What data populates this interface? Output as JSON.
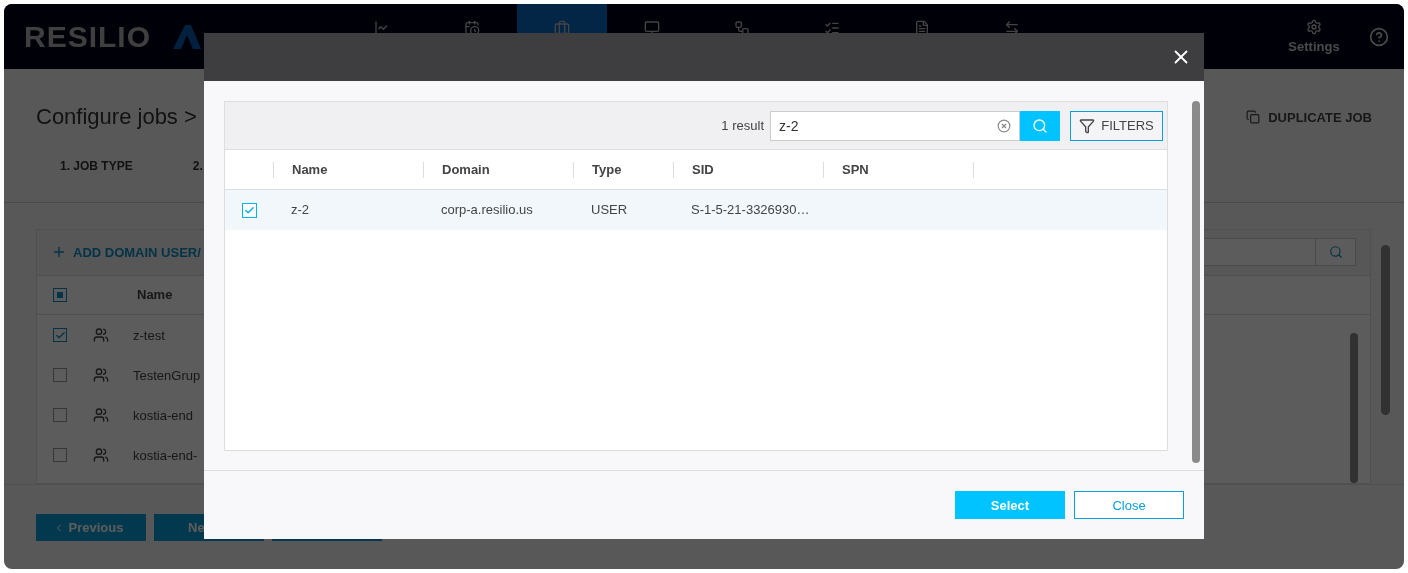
{
  "app": {
    "logo": "RESILIO",
    "nav": [
      {
        "selected": false
      },
      {
        "selected": false
      },
      {
        "selected": true
      },
      {
        "selected": false
      },
      {
        "selected": false
      },
      {
        "selected": false
      },
      {
        "selected": false
      },
      {
        "selected": false
      }
    ],
    "settings": "Settings"
  },
  "page": {
    "title": "Configure jobs >",
    "duplicate": "DUPLICATE JOB",
    "steps": [
      "1. JOB TYPE",
      "2."
    ],
    "add_button": "ADD DOMAIN USER/",
    "table": {
      "header_indeterminate": true,
      "column": "Name",
      "rows": [
        {
          "name": "z-test",
          "checked": true
        },
        {
          "name": "TestenGrup",
          "checked": false
        },
        {
          "name": "kostia-end",
          "checked": false
        },
        {
          "name": "kostia-end-",
          "checked": false
        }
      ]
    },
    "buttons": [
      "Previous",
      "Ne"
    ]
  },
  "dialog": {
    "result_count": "1 result",
    "search_value": "z-2",
    "filters": "FILTERS",
    "columns": [
      "Name",
      "Domain",
      "Type",
      "SID",
      "SPN"
    ],
    "rows": [
      {
        "selected": true,
        "cells": [
          "z-2",
          "corp-a.resilio.us",
          "USER",
          "S-1-5-21-3326930…",
          ""
        ]
      }
    ],
    "buttons": [
      "Select",
      "Close"
    ]
  }
}
